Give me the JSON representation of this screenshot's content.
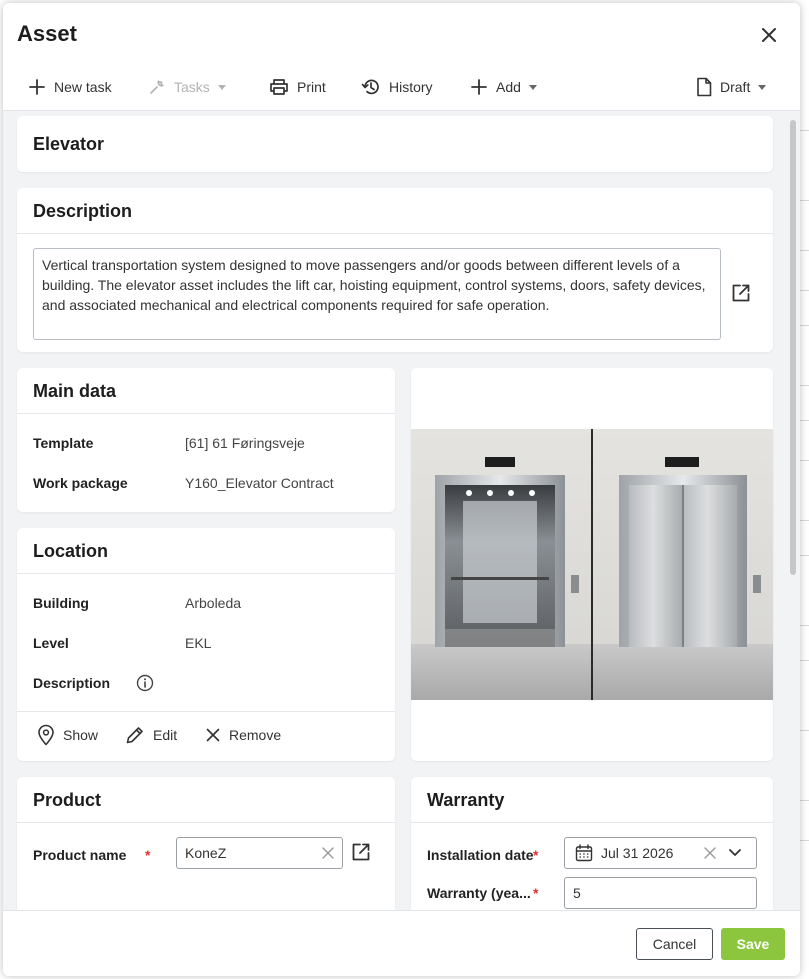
{
  "dialog": {
    "title": "Asset"
  },
  "toolbar": {
    "new_task": "New task",
    "tasks": "Tasks",
    "print": "Print",
    "history": "History",
    "add": "Add",
    "status": "Draft"
  },
  "asset": {
    "name": "Elevator"
  },
  "description": {
    "title": "Description",
    "text": "Vertical transportation system designed to move passengers and/or goods between different levels of a building. The elevator asset includes the lift car, hoisting equipment, control systems, doors, safety devices, and associated mechanical and electrical components required for safe operation."
  },
  "main_data": {
    "title": "Main data",
    "template_label": "Template",
    "template_value": "[61] 61 Føringsveje",
    "work_package_label": "Work package",
    "work_package_value": "Y160_Elevator Contract"
  },
  "location": {
    "title": "Location",
    "building_label": "Building",
    "building_value": "Arboleda",
    "level_label": "Level",
    "level_value": "EKL",
    "description_label": "Description",
    "show": "Show",
    "edit": "Edit",
    "remove": "Remove"
  },
  "product": {
    "title": "Product",
    "name_label": "Product name",
    "name_value": "KoneZ"
  },
  "warranty": {
    "title": "Warranty",
    "installation_label": "Installation date",
    "installation_value": "Jul 31 2026",
    "years_label": "Warranty (yea...",
    "years_value": "5"
  },
  "footer": {
    "cancel": "Cancel",
    "save": "Save"
  },
  "colors": {
    "accent": "#8cc63f",
    "required": "#dd3333"
  }
}
